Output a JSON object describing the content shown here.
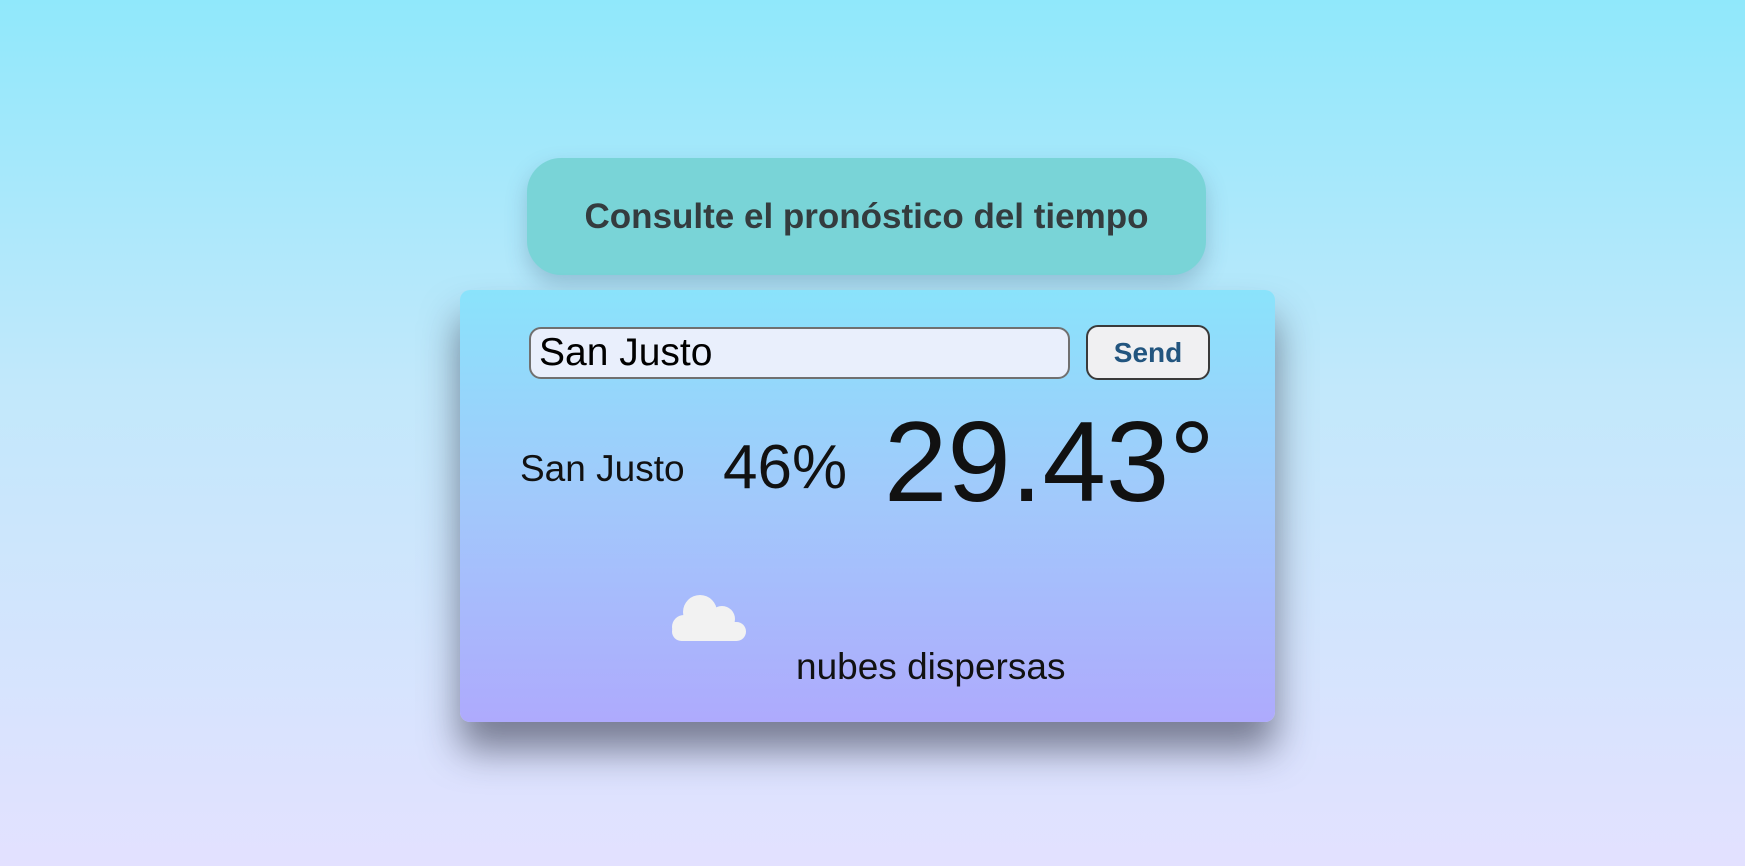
{
  "header": {
    "title": "Consulte el pronóstico del tiempo"
  },
  "search": {
    "value": "San Justo",
    "send_label": "Send"
  },
  "weather": {
    "city": "San Justo",
    "humidity": "46%",
    "temperature": "29.43°",
    "description": "nubes dispersas",
    "icon": "cloud-icon"
  },
  "colors": {
    "title_background": "#79d4d7",
    "card_gradient_top": "#8ae3fb",
    "card_gradient_bottom": "#aeaafd",
    "send_text": "#22557f"
  }
}
